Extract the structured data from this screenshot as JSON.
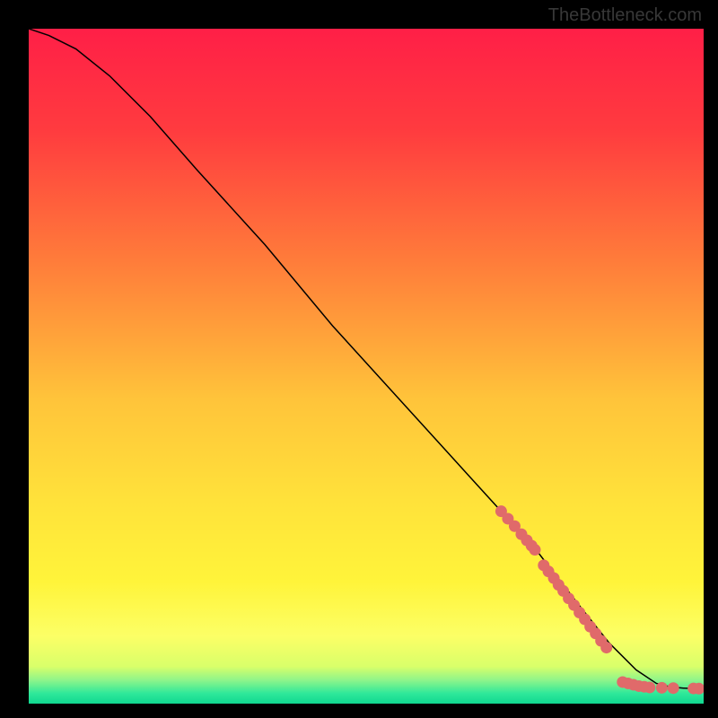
{
  "watermark": "TheBottleneck.com",
  "chart_data": {
    "type": "line",
    "title": "",
    "xlabel": "",
    "ylabel": "",
    "xlim": [
      0,
      100
    ],
    "ylim": [
      0,
      100
    ],
    "background_gradient": {
      "stops": [
        {
          "pos": 0.0,
          "color": "#ff1f47"
        },
        {
          "pos": 0.15,
          "color": "#ff3b3f"
        },
        {
          "pos": 0.35,
          "color": "#ff7e3a"
        },
        {
          "pos": 0.55,
          "color": "#ffc43a"
        },
        {
          "pos": 0.7,
          "color": "#ffe23a"
        },
        {
          "pos": 0.82,
          "color": "#fff43a"
        },
        {
          "pos": 0.9,
          "color": "#fcff66"
        },
        {
          "pos": 0.945,
          "color": "#d9ff6a"
        },
        {
          "pos": 0.965,
          "color": "#8ff58a"
        },
        {
          "pos": 0.985,
          "color": "#2ee89a"
        },
        {
          "pos": 1.0,
          "color": "#10d890"
        }
      ]
    },
    "series": [
      {
        "name": "curve",
        "stroke": "#000000",
        "x": [
          0,
          3,
          7,
          12,
          18,
          25,
          35,
          45,
          55,
          65,
          75,
          82,
          86,
          90,
          93,
          95,
          97,
          100
        ],
        "values": [
          100,
          99,
          97,
          93,
          87,
          79,
          68,
          56,
          45,
          34,
          23,
          14,
          9,
          5,
          3,
          2.5,
          2.3,
          2.2
        ]
      }
    ],
    "scatter": {
      "name": "highlighted-points",
      "color": "#e06a6a",
      "points": [
        {
          "x": 70,
          "y": 28.5
        },
        {
          "x": 71,
          "y": 27.4
        },
        {
          "x": 72,
          "y": 26.3
        },
        {
          "x": 73,
          "y": 25.1
        },
        {
          "x": 73.8,
          "y": 24.2
        },
        {
          "x": 74.5,
          "y": 23.4
        },
        {
          "x": 75,
          "y": 22.8
        },
        {
          "x": 76.3,
          "y": 20.5
        },
        {
          "x": 77,
          "y": 19.6
        },
        {
          "x": 77.8,
          "y": 18.6
        },
        {
          "x": 78.5,
          "y": 17.6
        },
        {
          "x": 79.2,
          "y": 16.7
        },
        {
          "x": 80,
          "y": 15.6
        },
        {
          "x": 80.8,
          "y": 14.6
        },
        {
          "x": 81.6,
          "y": 13.5
        },
        {
          "x": 82.4,
          "y": 12.5
        },
        {
          "x": 83.2,
          "y": 11.4
        },
        {
          "x": 84,
          "y": 10.4
        },
        {
          "x": 84.8,
          "y": 9.3
        },
        {
          "x": 85.6,
          "y": 8.3
        },
        {
          "x": 88,
          "y": 3.2
        },
        {
          "x": 88.8,
          "y": 3.0
        },
        {
          "x": 89.6,
          "y": 2.8
        },
        {
          "x": 90.4,
          "y": 2.6
        },
        {
          "x": 91.2,
          "y": 2.5
        },
        {
          "x": 92,
          "y": 2.4
        },
        {
          "x": 93.8,
          "y": 2.35
        },
        {
          "x": 95.5,
          "y": 2.3
        },
        {
          "x": 98.5,
          "y": 2.25
        },
        {
          "x": 99.3,
          "y": 2.22
        }
      ]
    }
  }
}
